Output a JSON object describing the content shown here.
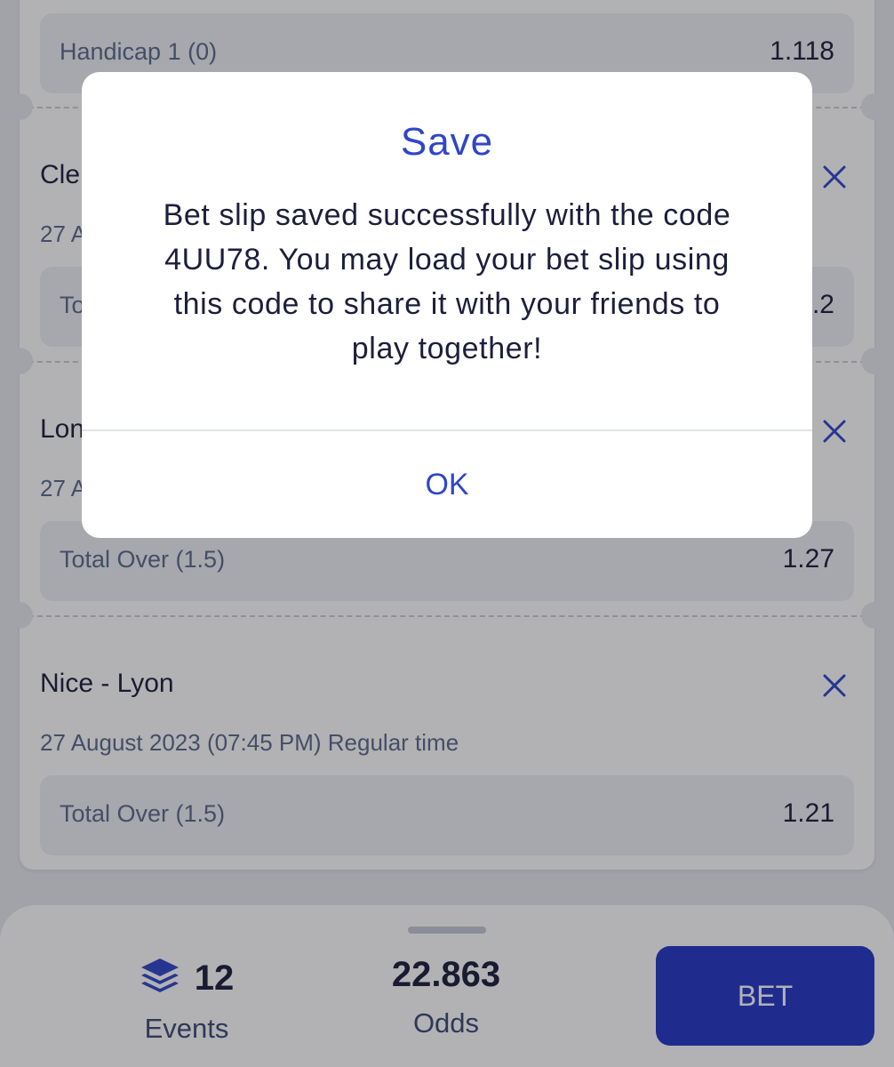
{
  "slip": {
    "events": [
      {
        "title": "",
        "date": "",
        "market": "Handicap 1 (0)",
        "odd": "1.118"
      },
      {
        "title": "Cle",
        "date": "27 A",
        "market": "To",
        "odd": ".2"
      },
      {
        "title": "Lon",
        "date": "27 A",
        "market": "Total Over (1.5)",
        "odd": "1.27"
      },
      {
        "title": "Nice - Lyon",
        "date": "27 August 2023 (07:45 PM) Regular time",
        "market": "Total Over (1.5)",
        "odd": "1.21"
      }
    ]
  },
  "summary": {
    "events_count": "12",
    "events_label": "Events",
    "odds_value": "22.863",
    "odds_label": "Odds",
    "bet_label": "BET"
  },
  "dialog": {
    "title": "Save",
    "message": "Bet slip saved successfully with the code 4UU78. You may load your bet slip using this code to share it with your friends to play together!",
    "ok_label": "OK"
  },
  "colors": {
    "accent": "#2f46c8",
    "bet_button": "#2438c4",
    "text_dark": "#1c1f3b",
    "text_muted": "#5c6a8a"
  },
  "icons": {
    "remove": "close-icon",
    "events": "layers-icon"
  }
}
